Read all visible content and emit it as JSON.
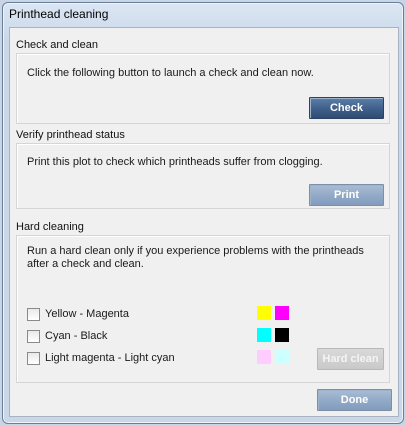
{
  "window": {
    "title": "Printhead cleaning"
  },
  "check_and_clean": {
    "heading": "Check and clean",
    "description": "Click the following button to launch a check and clean now.",
    "button": "Check"
  },
  "verify": {
    "heading": "Verify printhead status",
    "description": "Print this plot to check which printheads suffer from clogging.",
    "button": "Print"
  },
  "hard_cleaning": {
    "heading": "Hard cleaning",
    "description": "Run a hard clean only if you experience problems with the printheads after a check and clean.",
    "options": [
      {
        "label": "Yellow - Magenta",
        "checked": false,
        "colors": [
          "#ffff00",
          "#ff00ff"
        ]
      },
      {
        "label": "Cyan - Black",
        "checked": false,
        "colors": [
          "#00ffff",
          "#000000"
        ]
      },
      {
        "label": "Light magenta - Light cyan",
        "checked": false,
        "colors": [
          "#ffccff",
          "#ccffff"
        ]
      }
    ],
    "button": "Hard clean"
  },
  "footer": {
    "done": "Done"
  }
}
